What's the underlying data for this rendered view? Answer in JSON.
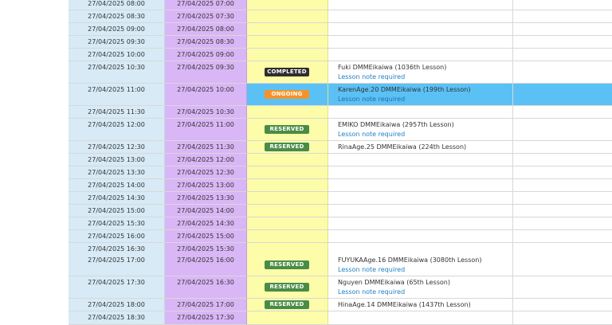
{
  "rows": [
    {
      "local": "27/04/2025 08:00",
      "jst": "27/04/2025 07:00"
    },
    {
      "local": "27/04/2025 08:30",
      "jst": "27/04/2025 07:30"
    },
    {
      "local": "27/04/2025 09:00",
      "jst": "27/04/2025 08:00"
    },
    {
      "local": "27/04/2025 09:30",
      "jst": "27/04/2025 08:30"
    },
    {
      "local": "27/04/2025 10:00",
      "jst": "27/04/2025 09:00"
    },
    {
      "local": "27/04/2025 10:30",
      "jst": "27/04/2025 09:30",
      "status": "COMPLETED",
      "teacher": "Fuki DMMEikaiwa (1036th Lesson)",
      "note": "Lesson note required"
    },
    {
      "local": "27/04/2025 11:00",
      "jst": "27/04/2025 10:00",
      "status": "ONGOING",
      "teacher": "KarenAge.20 DMMEikaiwa (199th Lesson)",
      "note": "Lesson note required"
    },
    {
      "local": "27/04/2025 11:30",
      "jst": "27/04/2025 10:30"
    },
    {
      "local": "27/04/2025 12:00",
      "jst": "27/04/2025 11:00",
      "status": "RESERVED",
      "teacher": "EMIKO DMMEikaiwa (2957th Lesson)",
      "note": "Lesson note required"
    },
    {
      "local": "27/04/2025 12:30",
      "jst": "27/04/2025 11:30",
      "status": "RESERVED",
      "teacher": "RinaAge.25 DMMEikaiwa (224th Lesson)"
    },
    {
      "local": "27/04/2025 13:00",
      "jst": "27/04/2025 12:00"
    },
    {
      "local": "27/04/2025 13:30",
      "jst": "27/04/2025 12:30"
    },
    {
      "local": "27/04/2025 14:00",
      "jst": "27/04/2025 13:00"
    },
    {
      "local": "27/04/2025 14:30",
      "jst": "27/04/2025 13:30"
    },
    {
      "local": "27/04/2025 15:00",
      "jst": "27/04/2025 14:00"
    },
    {
      "local": "27/04/2025 15:30",
      "jst": "27/04/2025 14:30"
    },
    {
      "local": "27/04/2025 16:00",
      "jst": "27/04/2025 15:00"
    },
    {
      "local": "27/04/2025 16:30",
      "jst": "27/04/2025 15:30"
    },
    {
      "local": "27/04/2025 17:00",
      "jst": "27/04/2025 16:00",
      "status": "RESERVED",
      "teacher": "FUYUKAAge.16 DMMEikaiwa (3080th Lesson)",
      "note": "Lesson note required"
    },
    {
      "local": "27/04/2025 17:30",
      "jst": "27/04/2025 16:30",
      "status": "RESERVED",
      "teacher": "Nguyen DMMEikaiwa (65th Lesson)",
      "note": "Lesson note required"
    },
    {
      "local": "27/04/2025 18:00",
      "jst": "27/04/2025 17:00",
      "status": "RESERVED",
      "teacher": "HinaAge.14 DMMEikaiwa (1437th Lesson)"
    },
    {
      "local": "27/04/2025 18:30",
      "jst": "27/04/2025 17:30"
    }
  ],
  "colors": {
    "completed": "#2e2e2e",
    "ongoing": "#f5932a",
    "reserved": "#4a8c47",
    "ongoing_row": "#5bc1f5",
    "local_col": "#d7eaf6",
    "jst_col": "#d9b6f5",
    "status_col": "#fdfca9",
    "link": "#1e7fc4"
  }
}
